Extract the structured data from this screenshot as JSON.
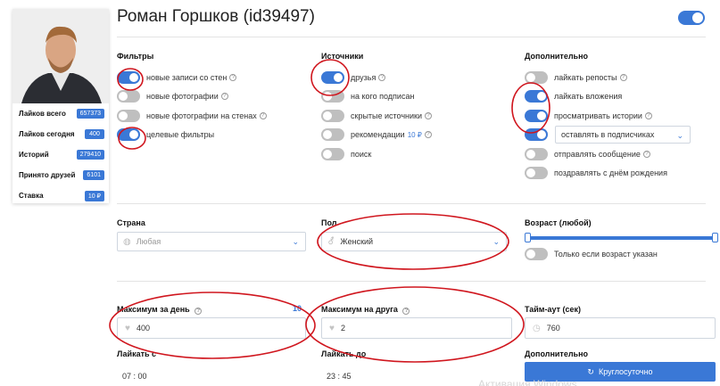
{
  "header": {
    "title": "Роман Горшков (id39497)",
    "main_toggle_on": true
  },
  "profile": {
    "stats": [
      {
        "label": "Лайков всего",
        "value": "657373"
      },
      {
        "label": "Лайков сегодня",
        "value": "400"
      },
      {
        "label": "Историй",
        "value": "279410"
      },
      {
        "label": "Принято друзей",
        "value": "6101"
      },
      {
        "label": "Ставка",
        "value": "10 ₽"
      }
    ]
  },
  "filters": {
    "heading": "Фильтры",
    "items": [
      {
        "label": "новые записи со стен",
        "on": true
      },
      {
        "label": "новые фотографии",
        "on": false
      },
      {
        "label": "новые фотографии на стенах",
        "on": false
      },
      {
        "label": "целевые фильтры",
        "on": true
      }
    ]
  },
  "sources": {
    "heading": "Источники",
    "items": [
      {
        "label": "друзья",
        "on": true,
        "price": ""
      },
      {
        "label": "на кого подписан",
        "on": false,
        "price": ""
      },
      {
        "label": "скрытые источники",
        "on": false,
        "price": ""
      },
      {
        "label": "рекомендации",
        "on": false,
        "price": "10 ₽"
      },
      {
        "label": "поиск",
        "on": false,
        "price": ""
      }
    ]
  },
  "extra": {
    "heading": "Дополнительно",
    "items": [
      {
        "label": "лайкать репосты",
        "on": false
      },
      {
        "label": "лайкать вложения",
        "on": true
      },
      {
        "label": "просматривать истории",
        "on": true
      }
    ],
    "stories_select": {
      "value": "оставлять в подписчиках",
      "on": true
    },
    "items2": [
      {
        "label": "отправлять сообщение",
        "on": false
      },
      {
        "label": "поздравлять с днём рождения",
        "on": false
      }
    ]
  },
  "country": {
    "label": "Страна",
    "value": "Любая"
  },
  "gender": {
    "label": "Пол",
    "value": "Женский"
  },
  "age": {
    "label": "Возраст (любой)",
    "only_if_label": "Только если возраст указан",
    "only_if_on": false
  },
  "limits": {
    "per_day": {
      "label": "Максимум за день",
      "value": "400",
      "side_value": "10"
    },
    "per_friend": {
      "label": "Максимум на друга",
      "value": "2"
    },
    "timeout": {
      "label": "Тайм-аут (сек)",
      "value": "760"
    }
  },
  "schedule": {
    "from": {
      "label": "Лайкать с",
      "hh": "07",
      "mm": "00"
    },
    "to": {
      "label": "Лайкать до",
      "hh": "23",
      "mm": "45"
    },
    "extra_label": "Дополнительно",
    "round_button": "Круглосуточно"
  },
  "watermark": "Активация Windows"
}
